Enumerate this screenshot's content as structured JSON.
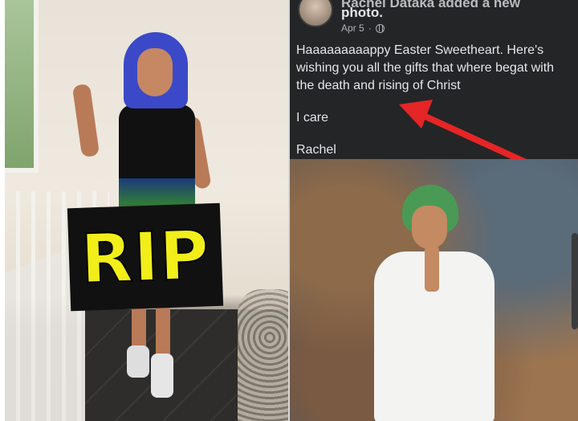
{
  "left_image": {
    "overlay_text": "RIP"
  },
  "post": {
    "author_truncated": "Rachel Dataka added a new",
    "post_type": "photo.",
    "date": "Apr 5",
    "audience_icon": "globe-icon",
    "body_lines": [
      "Haaaaaaaaappy Easter Sweetheart. Here's wishing you all the gifts that where begat with the death and rising of Christ",
      "I care",
      "Rachel"
    ]
  },
  "colors": {
    "post_bg": "#242526",
    "text": "#e4e6eb",
    "meta_text": "#b0b3b8",
    "rip_yellow": "#f2ee1a",
    "arrow_red": "#e52526"
  }
}
